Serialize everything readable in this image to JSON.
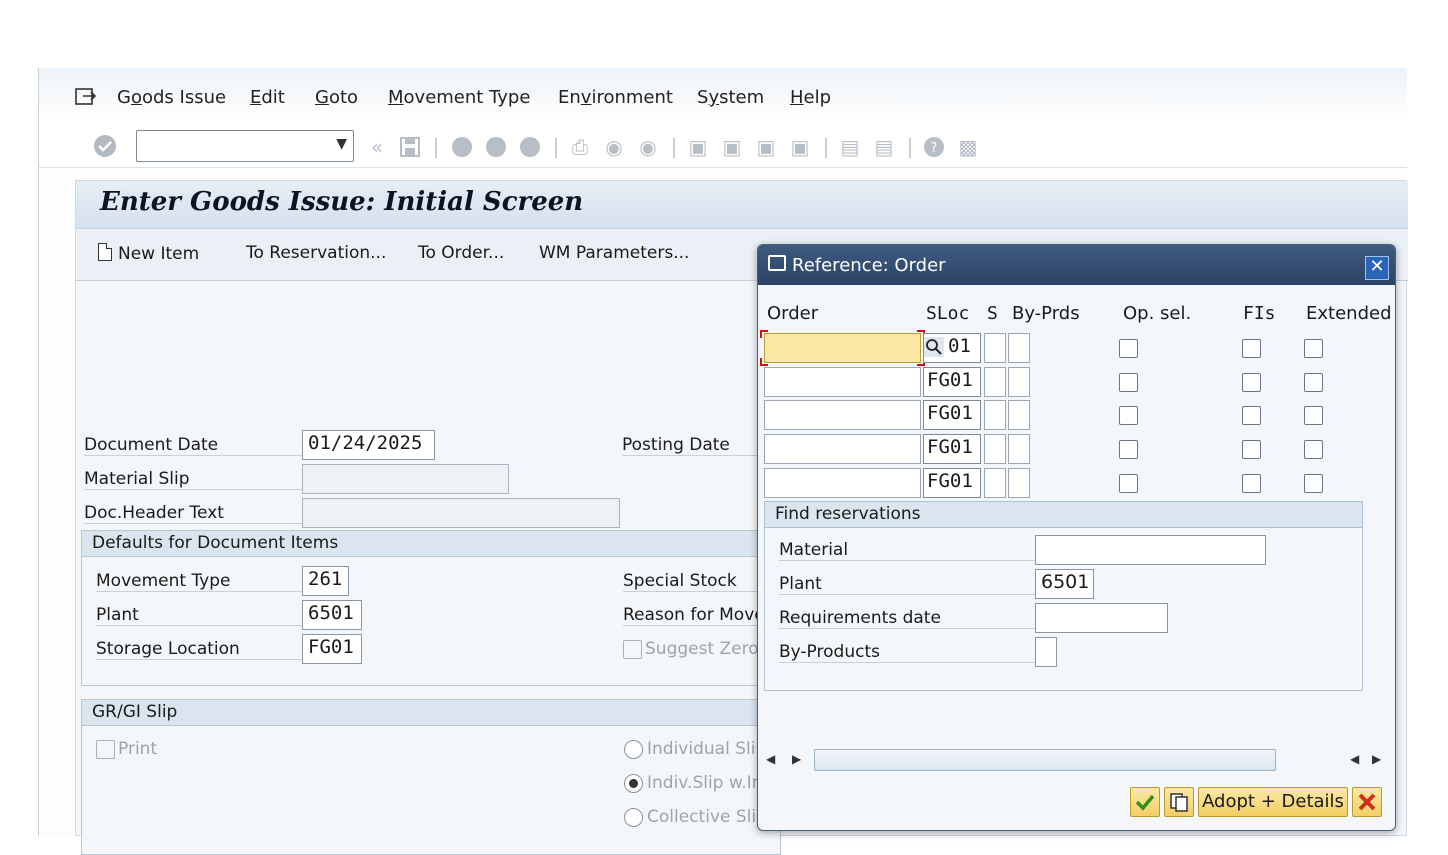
{
  "menu": {
    "items": [
      {
        "pre": "G",
        "u": "o",
        "post": "ods Issue"
      },
      {
        "pre": "",
        "u": "E",
        "post": "dit"
      },
      {
        "pre": "",
        "u": "G",
        "post": "oto"
      },
      {
        "pre": "",
        "u": "M",
        "post": "ovement Type"
      },
      {
        "pre": "En",
        "u": "v",
        "post": "ironment"
      },
      {
        "pre": "S",
        "u": "y",
        "post": "stem"
      },
      {
        "pre": "",
        "u": "H",
        "post": "elp"
      }
    ]
  },
  "toolbar": {
    "command_value": ""
  },
  "screen": {
    "title": "Enter Goods Issue: Initial Screen",
    "buttons": {
      "new_item": "New Item",
      "to_reservation": "To Reservation...",
      "to_order": "To Order...",
      "wm_parameters": "WM Parameters..."
    },
    "document_date_label": "Document Date",
    "document_date": "01/24/2025",
    "posting_date_label": "Posting Date",
    "material_slip_label": "Material Slip",
    "material_slip": "",
    "doc_header_text_label": "Doc.Header Text",
    "doc_header_text": "",
    "defaults": {
      "header": "Defaults for Document Items",
      "movement_type_label": "Movement Type",
      "movement_type": "261",
      "plant_label": "Plant",
      "plant": "6501",
      "storage_location_label": "Storage Location",
      "storage_location": "FG01",
      "special_stock_label": "Special Stock",
      "reason_label": "Reason for Move",
      "suggest_zero_label": "Suggest Zero"
    },
    "slip": {
      "header": "GR/GI Slip",
      "print_label": "Print",
      "individual_slip": "Individual Slip",
      "indiv_slip_w": "Indiv.Slip w.In",
      "collective_slip": "Collective Slip"
    }
  },
  "dialog": {
    "title": "Reference: Order",
    "columns": {
      "order": "Order",
      "sloc": "SLoc",
      "s": "S",
      "by_prds": "By-Prds",
      "op_sel": "Op. sel.",
      "fis": "FIs",
      "extended": "Extended"
    },
    "rows": [
      {
        "order": "",
        "sloc": "01"
      },
      {
        "order": "",
        "sloc": "FG01"
      },
      {
        "order": "",
        "sloc": "FG01"
      },
      {
        "order": "",
        "sloc": "FG01"
      },
      {
        "order": "",
        "sloc": "FG01"
      }
    ],
    "find": {
      "header": "Find reservations",
      "material_label": "Material",
      "material": "",
      "plant_label": "Plant",
      "plant": "6501",
      "req_date_label": "Requirements date",
      "req_date": "",
      "by_products_label": "By-Products"
    },
    "footer": {
      "adopt_details": "Adopt + Details"
    }
  },
  "colors": {
    "dialog_title_bg": "#2c4566",
    "focus_field": "#fbe7a3",
    "button_gold": "#f3cf63"
  }
}
